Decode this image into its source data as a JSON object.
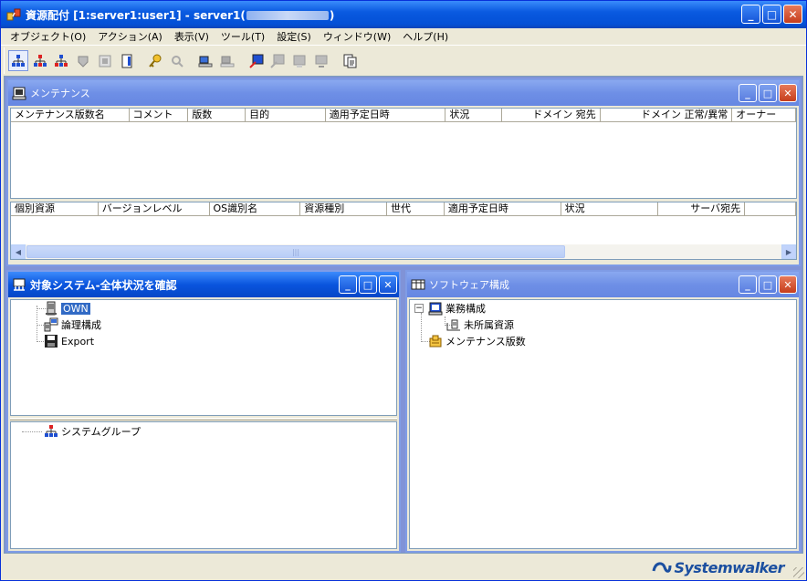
{
  "window": {
    "title_prefix": "資源配付 [1:server1:user1] - server1(",
    "title_suffix": ")"
  },
  "menu": [
    "オブジェクト(O)",
    "アクション(A)",
    "表示(V)",
    "ツール(T)",
    "設定(S)",
    "ウィンドウ(W)",
    "ヘルプ(H)"
  ],
  "toolbar": {
    "buttons": [
      "system-tree-icon",
      "system-tree-red-icon",
      "system-tree-blue-icon",
      "resource-icon",
      "deploy-icon",
      "doc-icon",
      "key-icon",
      "key-search-icon",
      "server-pc-icon",
      "server-pc2-icon",
      "monitor-arrow-icon",
      "monitor-icon2",
      "monitor-icon3",
      "monitor-icon4",
      "report-icon"
    ]
  },
  "maintenance": {
    "title": "メンテナンス",
    "upper_columns": [
      "メンテナンス版数名",
      "コメント",
      "版数",
      "目的",
      "適用予定日時",
      "状況",
      "ドメイン 宛先",
      "ドメイン 正常/異常",
      "オーナー"
    ],
    "lower_columns": [
      "個別資源",
      "バージョンレベル",
      "OS識別名",
      "資源種別",
      "世代",
      "適用予定日時",
      "状況",
      "サーバ宛先",
      ""
    ]
  },
  "target_system": {
    "title": "対象システム-全体状況を確認",
    "tree": [
      {
        "label": "OWN",
        "icon": "server-icon",
        "selected": true
      },
      {
        "label": "論理構成",
        "icon": "logical-config-icon"
      },
      {
        "label": "Export",
        "icon": "floppy-icon"
      }
    ],
    "lower_tree": [
      {
        "label": "システムグループ",
        "icon": "system-group-icon"
      }
    ]
  },
  "software": {
    "title": "ソフトウェア構成",
    "tree": [
      {
        "label": "業務構成",
        "icon": "business-config-icon",
        "expander": "−"
      },
      {
        "label": "未所属資源",
        "icon": "unassigned-resource-icon"
      },
      {
        "label": "メンテナンス版数",
        "icon": "maintenance-version-icon"
      }
    ]
  },
  "status": {
    "brand": "Systemwalker"
  },
  "colors": {
    "title_active": "#0a55de",
    "title_inactive": "#7a97e8",
    "workspace": "#8093d7",
    "selection": "#316ac5",
    "brand": "#1b4fa0"
  }
}
